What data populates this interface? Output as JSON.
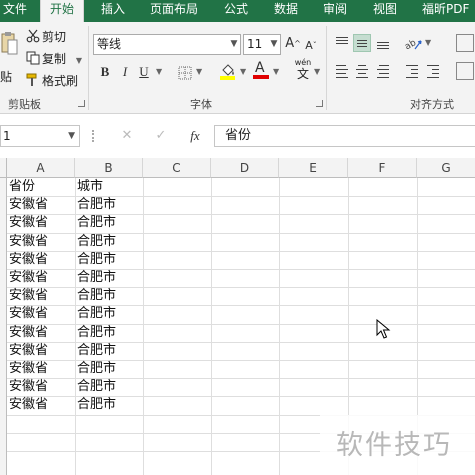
{
  "tabs": [
    {
      "label": "文件",
      "active": false
    },
    {
      "label": "开始",
      "active": true
    },
    {
      "label": "插入",
      "active": false
    },
    {
      "label": "页面布局",
      "active": false
    },
    {
      "label": "公式",
      "active": false
    },
    {
      "label": "数据",
      "active": false
    },
    {
      "label": "审阅",
      "active": false
    },
    {
      "label": "视图",
      "active": false
    },
    {
      "label": "福昕PDF",
      "active": false
    }
  ],
  "clipboard": {
    "paste_label": "贴",
    "cut_label": "剪切",
    "copy_label": "复制",
    "format_painter_label": "格式刷",
    "group_label": "剪贴板"
  },
  "font": {
    "font_name": "等线",
    "font_size": "11",
    "group_label": "字体",
    "bold": "B",
    "italic": "I",
    "underline": "U",
    "grow": "A",
    "shrink": "A",
    "phonetic": "wén",
    "phonetic_char": "文"
  },
  "alignment": {
    "group_label": "对齐方式",
    "selected": "middle-align"
  },
  "formula_bar": {
    "name_box": "1",
    "fx_label": "fx",
    "content": "省份"
  },
  "sheet": {
    "columns": [
      "A",
      "B",
      "C",
      "D",
      "E",
      "F",
      "G"
    ],
    "header_row": {
      "a": "省份",
      "b": "城市"
    },
    "rows": [
      {
        "a": "安徽省",
        "b": "合肥市"
      },
      {
        "a": "安徽省",
        "b": "合肥市"
      },
      {
        "a": "安徽省",
        "b": "合肥市"
      },
      {
        "a": "安徽省",
        "b": "合肥市"
      },
      {
        "a": "安徽省",
        "b": "合肥市"
      },
      {
        "a": "安徽省",
        "b": "合肥市"
      },
      {
        "a": "安徽省",
        "b": "合肥市"
      },
      {
        "a": "安徽省",
        "b": "合肥市"
      },
      {
        "a": "安徽省",
        "b": "合肥市"
      },
      {
        "a": "安徽省",
        "b": "合肥市"
      },
      {
        "a": "安徽省",
        "b": "合肥市"
      },
      {
        "a": "安徽省",
        "b": "合肥市"
      }
    ]
  },
  "watermark": "软件技巧",
  "colors": {
    "accent": "#217346",
    "ribbon_bg": "#f3f3f3",
    "selected_align": "#c5ddd0"
  }
}
